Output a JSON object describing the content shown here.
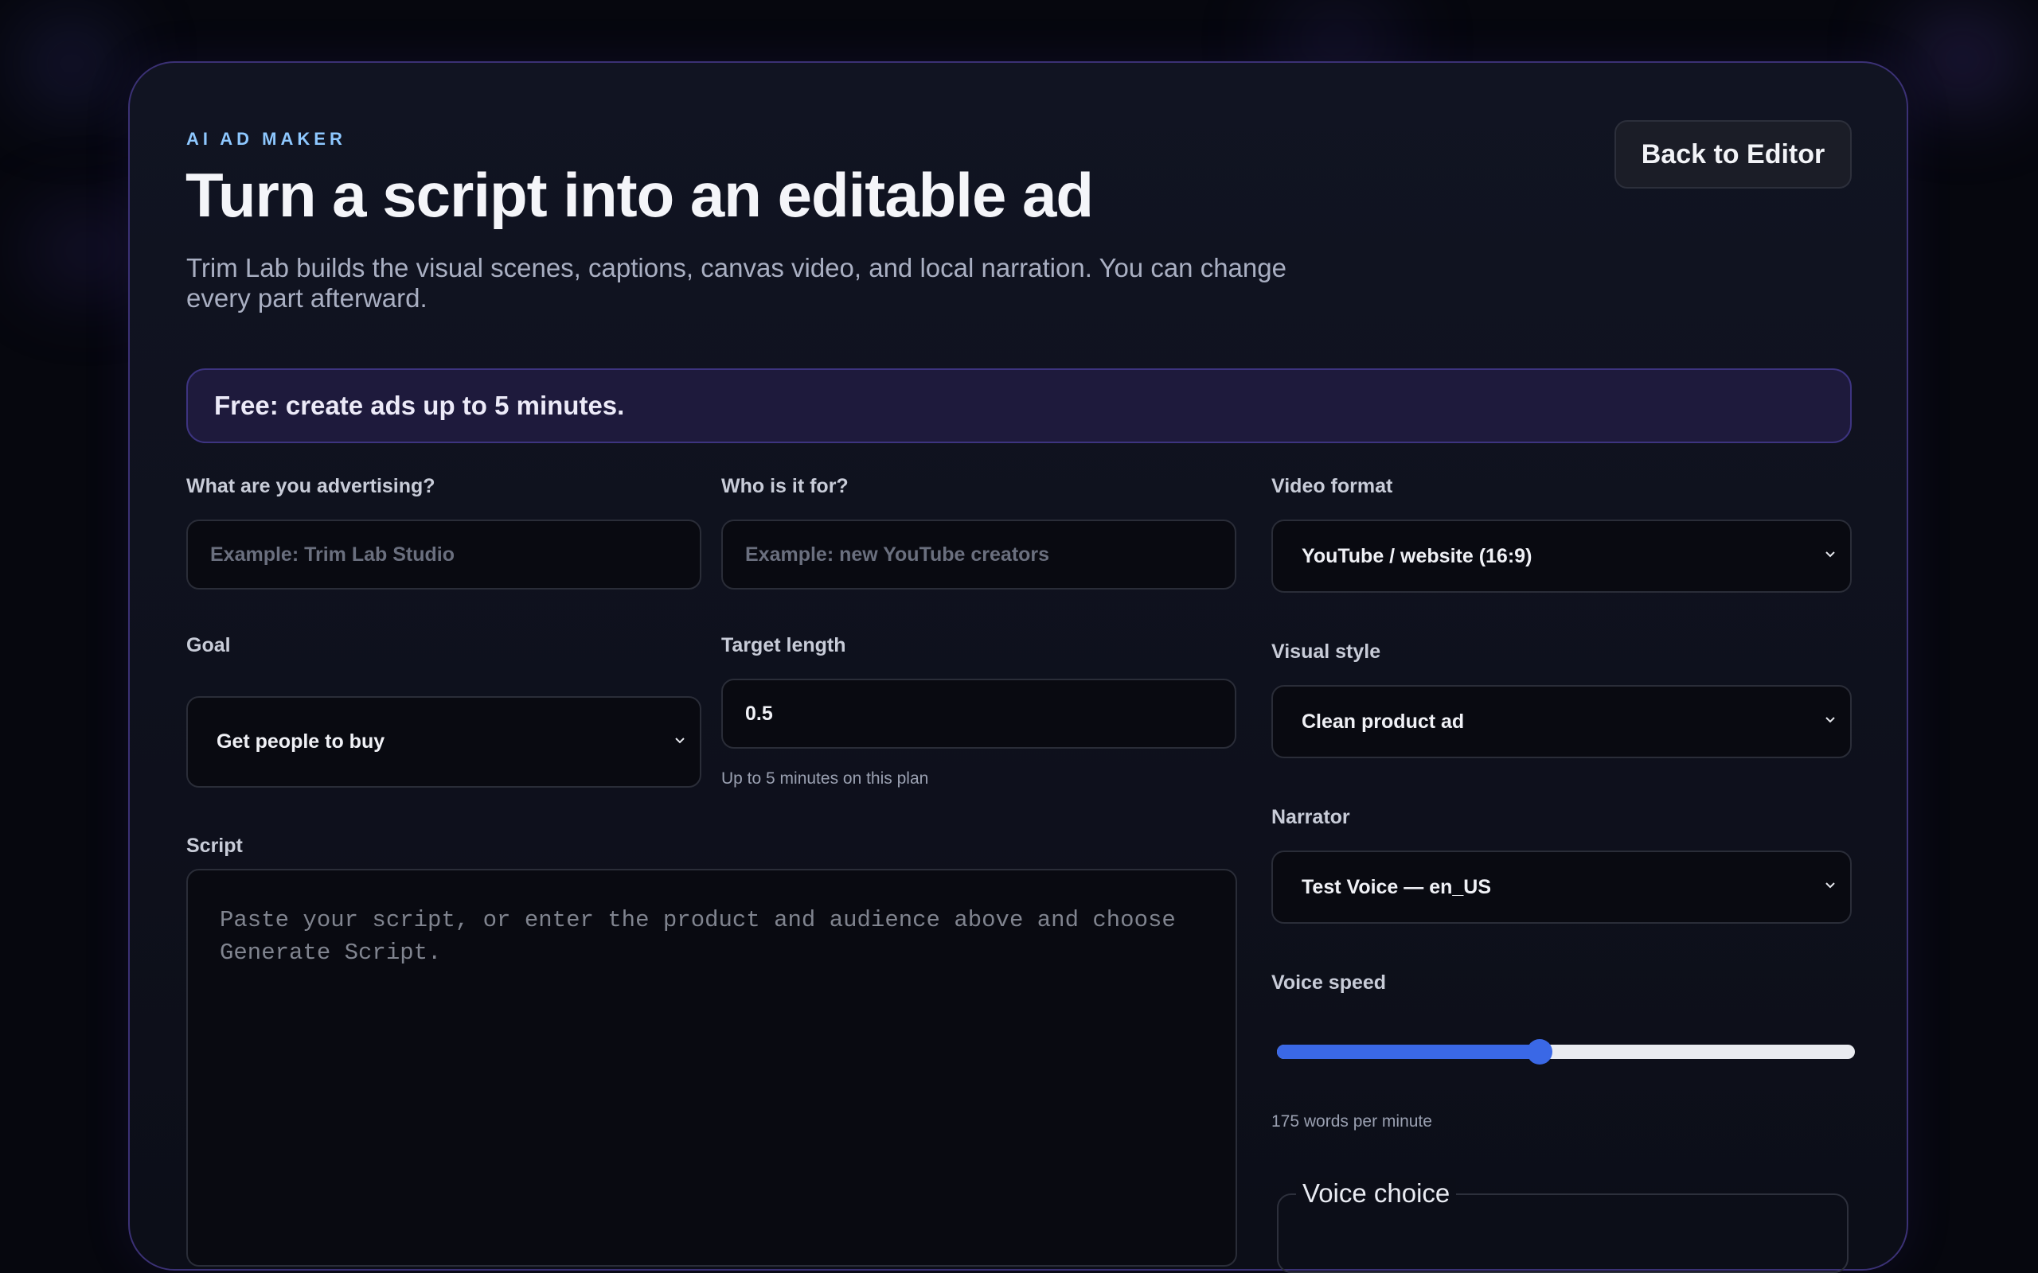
{
  "header": {
    "eyebrow": "AI AD MAKER",
    "title": "Turn a script into an editable ad",
    "subtitle": "Trim Lab builds the visual scenes, captions, canvas video, and local narration. You can change every part afterward.",
    "back_button": "Back to Editor"
  },
  "plan_banner": "Free: create ads up to 5 minutes.",
  "form": {
    "product": {
      "label": "What are you advertising?",
      "placeholder": "Example: Trim Lab Studio",
      "value": ""
    },
    "audience": {
      "label": "Who is it for?",
      "placeholder": "Example: new YouTube creators",
      "value": ""
    },
    "goal": {
      "label": "Goal",
      "selected": "Get people to buy"
    },
    "target_length": {
      "label": "Target length",
      "value": "0.5",
      "helper": "Up to 5 minutes on this plan"
    },
    "script": {
      "label": "Script",
      "placeholder": "Paste your script, or enter the product and audience above and choose Generate Script.",
      "value": ""
    },
    "video_format": {
      "label": "Video format",
      "selected": "YouTube / website (16:9)"
    },
    "visual_style": {
      "label": "Visual style",
      "selected": "Clean product ad"
    },
    "narrator": {
      "label": "Narrator",
      "selected": "Test Voice — en_US"
    },
    "voice_speed": {
      "label": "Voice speed",
      "fraction": 0.455,
      "helper": "175 words per minute"
    },
    "voice_choice": {
      "legend": "Voice choice"
    }
  },
  "colors": {
    "accent": "#3a68e6",
    "eyebrow": "#8ec8ff",
    "banner_bg": "#1e1a3c",
    "card_border": "#3b3175"
  },
  "icons": {
    "select_chevron": "chevron-down-icon"
  }
}
